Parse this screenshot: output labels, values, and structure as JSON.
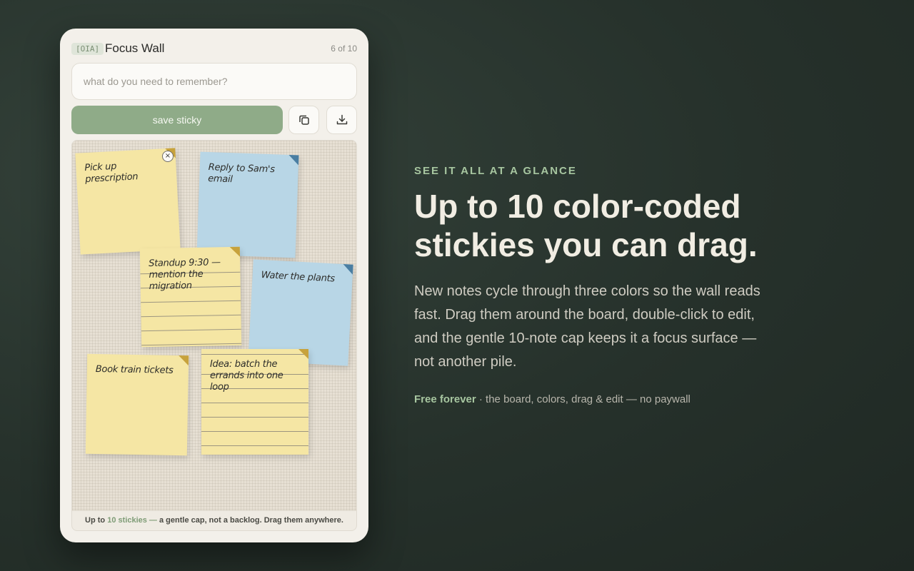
{
  "popup": {
    "badge": "[OIA]",
    "title": "Focus Wall",
    "count": "6 of 10",
    "input_placeholder": "what do you need to remember?",
    "input_value": "",
    "save_label": "save sticky",
    "copy_icon": "copy-icon",
    "download_icon": "download-icon"
  },
  "stickies": [
    {
      "text": "Pick up prescription",
      "color": "yellow",
      "style": "plain"
    },
    {
      "text": "Reply to Sam's email",
      "color": "blue",
      "style": "plain"
    },
    {
      "text": "Standup 9:30 — mention the migration",
      "color": "yellow",
      "style": "lined"
    },
    {
      "text": "Water the plants",
      "color": "blue",
      "style": "plain"
    },
    {
      "text": "Book train tickets",
      "color": "yellow",
      "style": "plain"
    },
    {
      "text": "Idea: batch the errands into one loop",
      "color": "yellow",
      "style": "lined"
    }
  ],
  "board_footer": {
    "prefix": "Up to ",
    "accent": "10 stickies —",
    "suffix": " a gentle cap, not a backlog. Drag them anywhere."
  },
  "hero": {
    "eyebrow": "SEE IT ALL AT A GLANCE",
    "headline": "Up to 10 color-coded stickies you can drag.",
    "body": "New notes cycle through three colors so the wall reads fast. Drag them around the board, double-click to edit, and the gentle 10-note cap keeps it a focus surface — not another pile.",
    "footnote_strong": "Free forever",
    "footnote_rest": " · the board, colors, drag & edit — no paywall"
  },
  "colors": {
    "accent_green": "#8fab88",
    "sticky_yellow": "#f5e6a4",
    "sticky_blue": "#b8d6e6",
    "background": "#26312b"
  }
}
